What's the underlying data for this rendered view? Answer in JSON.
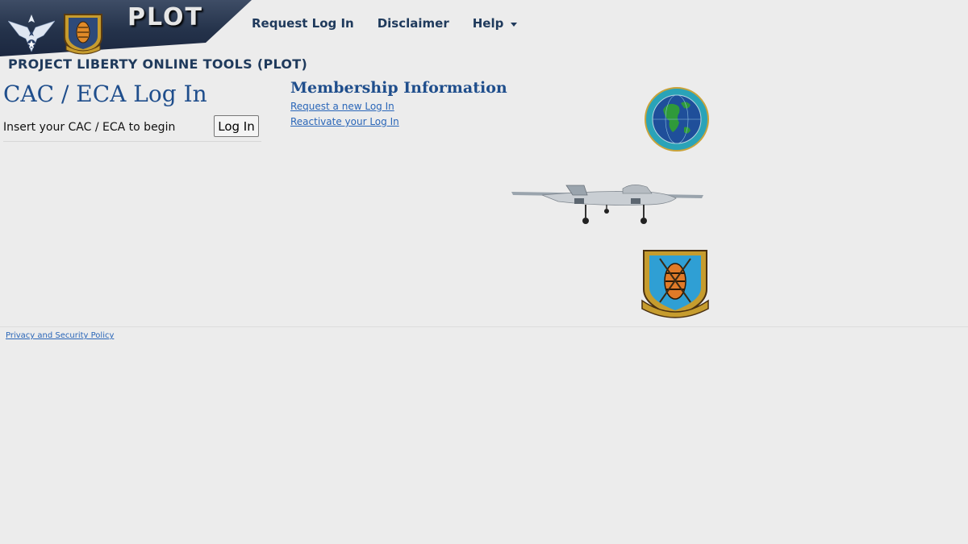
{
  "header": {
    "brand": "PLOT",
    "subtitle": "PROJECT LIBERTY ONLINE TOOLS (PLOT)"
  },
  "nav": {
    "items": [
      {
        "label": "Request Log In"
      },
      {
        "label": "Disclaimer"
      },
      {
        "label": "Help"
      }
    ]
  },
  "login": {
    "title": "CAC / ECA Log In",
    "prompt": "Insert your CAC / ECA to begin",
    "button_label": "Log In"
  },
  "membership": {
    "title": "Membership Information",
    "links": [
      {
        "label": "Request a new Log In"
      },
      {
        "label": "Reactivate your Log In"
      }
    ]
  },
  "footer": {
    "privacy_label": "Privacy and Security Policy"
  },
  "images": {
    "af_logo": "air-force-wings-logo",
    "badge_small": "big-safari-badge",
    "globe": "globe-emblem",
    "plane": "aircraft-photo",
    "badge_big": "big-safari-program-badge"
  },
  "colors": {
    "banner": "#24324a",
    "nav_text": "#1f3a5c",
    "heading_blue": "#1f4e8c",
    "link": "#2a66b8",
    "background": "#ececec"
  }
}
